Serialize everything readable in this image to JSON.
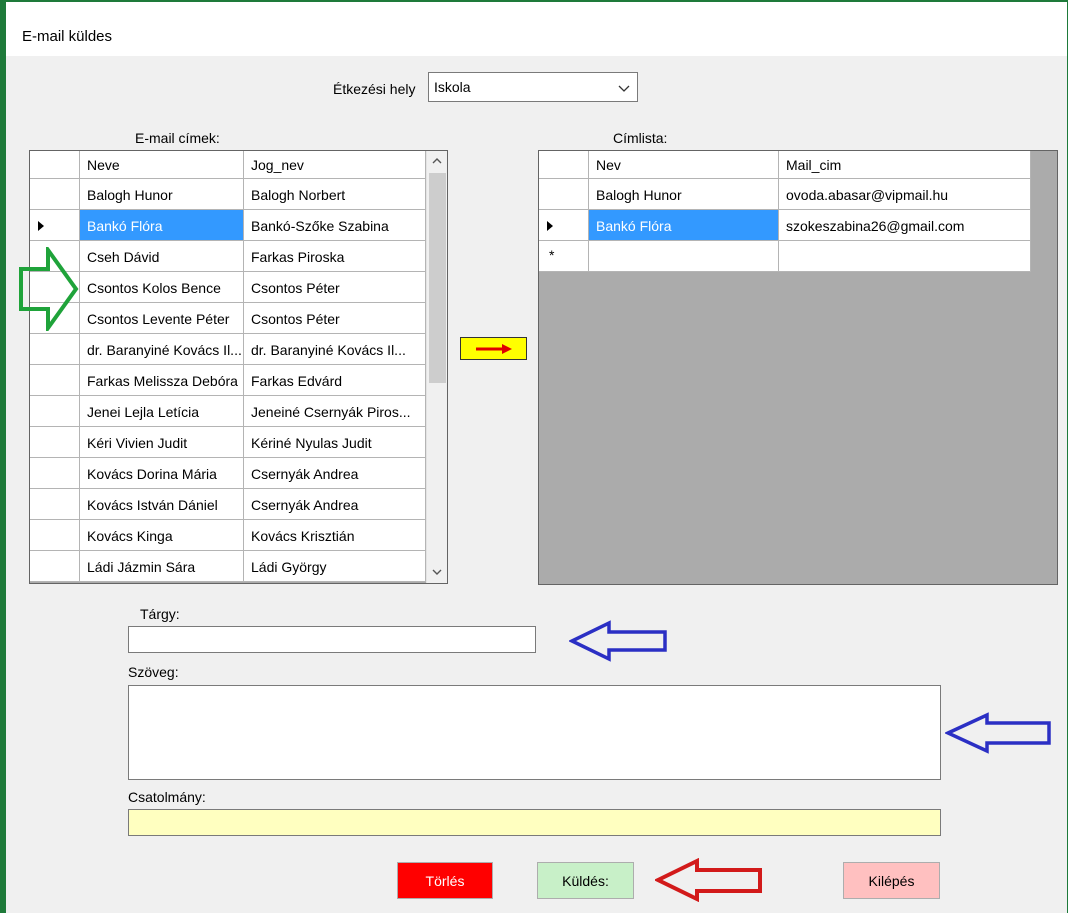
{
  "window": {
    "title": "E-mail küldes"
  },
  "location": {
    "label": "Étkezési hely",
    "value": "Iskola"
  },
  "email_list": {
    "label": "E-mail címek:",
    "columns": [
      "Neve",
      "Jog_nev"
    ],
    "selected_index": 1,
    "rows": [
      [
        "Balogh Hunor",
        "Balogh Norbert"
      ],
      [
        "Bankó Flóra",
        "Bankó-Szőke Szabina"
      ],
      [
        "Cseh Dávid",
        "Farkas Piroska"
      ],
      [
        "Csontos Kolos Bence",
        "Csontos Péter"
      ],
      [
        "Csontos Levente Péter",
        "Csontos Péter"
      ],
      [
        "dr. Baranyiné Kovács Il...",
        "dr. Baranyiné Kovács Il..."
      ],
      [
        "Farkas Melissza Debóra",
        "Farkas Edvárd"
      ],
      [
        "Jenei Lejla Letícia",
        "Jeneiné Csernyák Piros..."
      ],
      [
        "Kéri Vivien Judit",
        "Kériné Nyulas Judit"
      ],
      [
        "Kovács Dorina Mária",
        "Csernyák Andrea"
      ],
      [
        "Kovács István Dániel",
        "Csernyák Andrea"
      ],
      [
        "Kovács Kinga",
        "Kovács Krisztián"
      ],
      [
        "Ládi Jázmin Sára",
        "Ládi György"
      ]
    ]
  },
  "address_list": {
    "label": "Címlista:",
    "columns": [
      "Nev",
      "Mail_cim"
    ],
    "rows": [
      [
        "Balogh Hunor",
        "ovoda.abasar@vipmail.hu"
      ],
      [
        "Bankó Flóra",
        "szokeszabina26@gmail.com"
      ]
    ]
  },
  "subject": {
    "label": "Tárgy:",
    "value": ""
  },
  "body": {
    "label": "Szöveg:",
    "value": ""
  },
  "attachment": {
    "label": "Csatolmány:",
    "value": ""
  },
  "buttons": {
    "delete": "Törlés",
    "send": "Küldés:",
    "exit": "Kilépés"
  },
  "colors": {
    "green_arrow": "#1fa33a",
    "blue_arrow": "#2b2fc4",
    "red_arrow": "#d21a1a",
    "delete_btn": "#ff0000",
    "send_btn": "#c8f0c8",
    "exit_btn": "#ffc0c0",
    "attachment_bg": "#ffffc0",
    "transfer_btn": "#ffff00"
  }
}
